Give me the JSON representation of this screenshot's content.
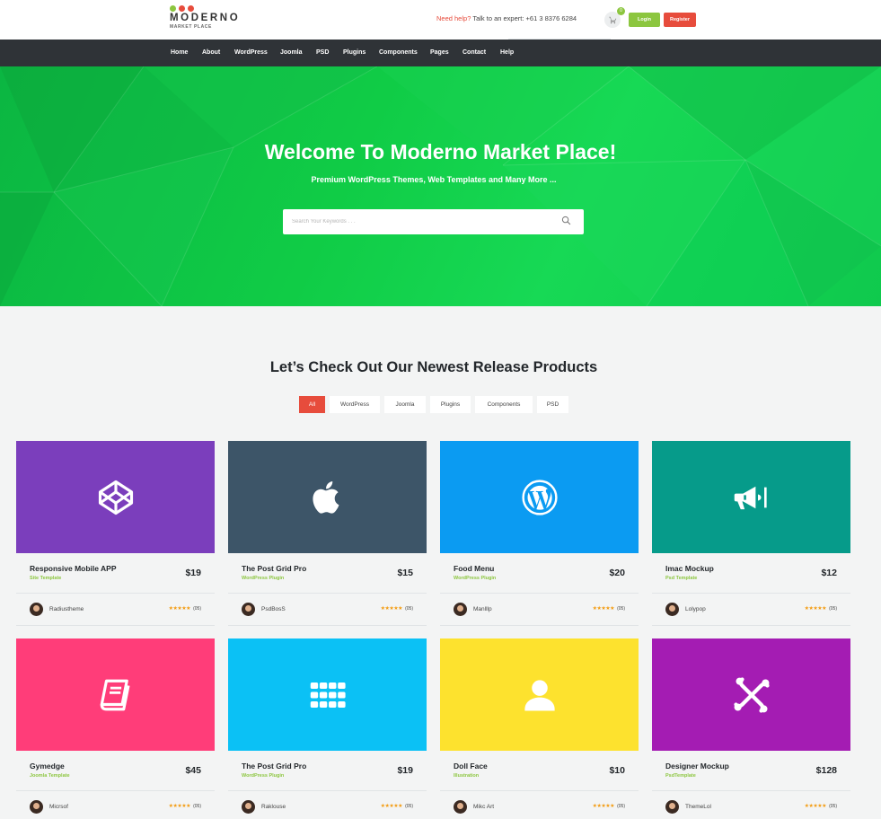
{
  "header": {
    "logo_text": "MODERNO",
    "logo_sub": "MARKET PLACE",
    "logo_dot_colors": [
      "#8cc63f",
      "#e74c3c",
      "#e74c3c"
    ],
    "help_label": "Need help?",
    "help_text": " Talk to an expert: +61 3 8376 6284",
    "cart_count": "0",
    "login_label": "Login",
    "register_label": "Register"
  },
  "nav": {
    "items": [
      "Home",
      "About",
      "WordPress",
      "Joomla",
      "PSD",
      "Plugins",
      "Components",
      "Pages",
      "Contact",
      "Help"
    ]
  },
  "hero": {
    "title": "Welcome To Moderno Market Place!",
    "subtitle": "Premium WordPress Themes, Web Templates and Many More ...",
    "search_placeholder": "Search Your Keywords . . ."
  },
  "products_section": {
    "title": "Let’s Check Out Our Newest Release Products",
    "filters": [
      "All",
      "WordPress",
      "Joomla",
      "Plugins",
      "Components",
      "PSD"
    ],
    "active_filter": "All",
    "items": [
      {
        "name": "Responsive Mobile APP",
        "category": "Site Template",
        "price": "$19",
        "author": "Radiustheme",
        "stars": "★★★★★",
        "reviews": "(05)",
        "color": "#7b3ebc",
        "icon": "codepen-icon"
      },
      {
        "name": "The Post Grid Pro",
        "category": "WordPress Plugin",
        "price": "$15",
        "author": "PsdBosS",
        "stars": "★★★★★",
        "reviews": "(05)",
        "color": "#3d5568",
        "icon": "apple-icon"
      },
      {
        "name": "Food Menu",
        "category": "WordPress Plugin",
        "price": "$20",
        "author": "Manlllp",
        "stars": "★★★★★",
        "reviews": "(05)",
        "color": "#0b9bf2",
        "icon": "wordpress-icon"
      },
      {
        "name": "Imac Mockup",
        "category": "Psd Template",
        "price": "$12",
        "author": "Lolypop",
        "stars": "★★★★★",
        "reviews": "(05)",
        "color": "#069b8a",
        "icon": "megaphone-icon"
      },
      {
        "name": "Gymedge",
        "category": "Joomla Template",
        "price": "$45",
        "author": "Micrsof",
        "stars": "★★★★★",
        "reviews": "(05)",
        "color": "#ff3d79",
        "icon": "book-icon"
      },
      {
        "name": "The Post Grid Pro",
        "category": "WordPress Plugin",
        "price": "$19",
        "author": "Raklouse",
        "stars": "★★★★★",
        "reviews": "(05)",
        "color": "#0bc1f5",
        "icon": "grid-icon"
      },
      {
        "name": "Doll Face",
        "category": "Illustration",
        "price": "$10",
        "author": "Mikc Art",
        "stars": "★★★★★",
        "reviews": "(05)",
        "color": "#fde22e",
        "icon": "user-icon"
      },
      {
        "name": "Designer Mockup",
        "category": "PsdTemplate",
        "price": "$128",
        "author": "ThemeLol",
        "stars": "★★★★★",
        "reviews": "(05)",
        "color": "#a41cb3",
        "icon": "joomla-icon"
      }
    ]
  }
}
